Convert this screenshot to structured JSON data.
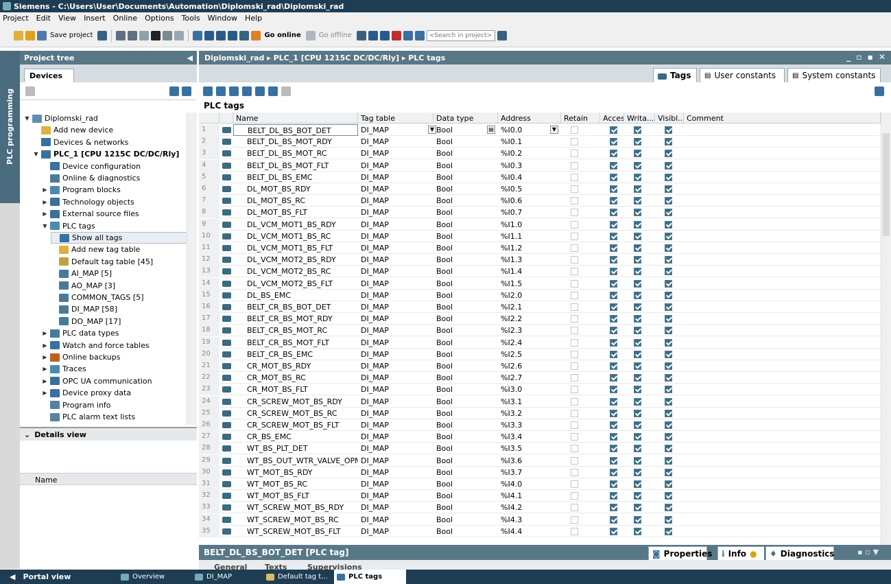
{
  "window": {
    "title": "Siemens - C:\\Users\\User\\Documents\\Automation\\Diplomski_rad\\Diplomski_rad"
  },
  "menu": [
    "Project",
    "Edit",
    "View",
    "Insert",
    "Online",
    "Options",
    "Tools",
    "Window",
    "Help"
  ],
  "toolbar": {
    "save_label": "Save project",
    "go_online": "Go online",
    "go_offline": "Go offline",
    "search_placeholder": "<Search in project>"
  },
  "sidebar_tab": "PLC programming",
  "project_tree": {
    "title": "Project tree",
    "devices_tab": "Devices",
    "items": [
      {
        "label": "Diplomski_rad",
        "indent": 0,
        "arrow": "▼"
      },
      {
        "label": "Add new device",
        "indent": 1,
        "arrow": ""
      },
      {
        "label": "Devices & networks",
        "indent": 1,
        "arrow": ""
      },
      {
        "label": "PLC_1 [CPU 1215C DC/DC/Rly]",
        "indent": 1,
        "arrow": "▼"
      },
      {
        "label": "Device configuration",
        "indent": 2,
        "arrow": ""
      },
      {
        "label": "Online & diagnostics",
        "indent": 2,
        "arrow": ""
      },
      {
        "label": "Program blocks",
        "indent": 2,
        "arrow": "▶"
      },
      {
        "label": "Technology objects",
        "indent": 2,
        "arrow": "▶"
      },
      {
        "label": "External source files",
        "indent": 2,
        "arrow": "▶"
      },
      {
        "label": "PLC tags",
        "indent": 2,
        "arrow": "▼"
      },
      {
        "label": "Show all tags",
        "indent": 3,
        "arrow": ""
      },
      {
        "label": "Add new tag table",
        "indent": 3,
        "arrow": ""
      },
      {
        "label": "Default tag table [45]",
        "indent": 3,
        "arrow": ""
      },
      {
        "label": "AI_MAP [5]",
        "indent": 3,
        "arrow": ""
      },
      {
        "label": "AO_MAP [3]",
        "indent": 3,
        "arrow": ""
      },
      {
        "label": "COMMON_TAGS [5]",
        "indent": 3,
        "arrow": ""
      },
      {
        "label": "DI_MAP [58]",
        "indent": 3,
        "arrow": ""
      },
      {
        "label": "DO_MAP [17]",
        "indent": 3,
        "arrow": ""
      },
      {
        "label": "PLC data types",
        "indent": 2,
        "arrow": "▶"
      },
      {
        "label": "Watch and force tables",
        "indent": 2,
        "arrow": "▶"
      },
      {
        "label": "Online backups",
        "indent": 2,
        "arrow": "▶"
      },
      {
        "label": "Traces",
        "indent": 2,
        "arrow": "▶"
      },
      {
        "label": "OPC UA communication",
        "indent": 2,
        "arrow": "▶"
      },
      {
        "label": "Device proxy data",
        "indent": 2,
        "arrow": "▶"
      },
      {
        "label": "Program info",
        "indent": 2,
        "arrow": ""
      },
      {
        "label": "PLC alarm text lists",
        "indent": 2,
        "arrow": ""
      }
    ]
  },
  "details": {
    "title": "Details view",
    "name_col": "Name"
  },
  "editor": {
    "breadcrumb": "Diplomski_rad  ▸  PLC_1 [CPU 1215C DC/DC/Rly]  ▸  PLC tags",
    "window_controls": "_ ▫ ▪ ✕",
    "tabs": [
      "Tags",
      "User constants",
      "System constants"
    ],
    "section_title": "PLC tags",
    "columns": [
      "",
      "",
      "Name",
      "Tag table",
      "Data type",
      "Address",
      "Retain",
      "Acces...",
      "Writa...",
      "Visibl...",
      "Comment"
    ],
    "rows": [
      [
        "1",
        "BELT_DL_BS_BOT_DET",
        "DI_MAP",
        "Bool",
        "%I0.0"
      ],
      [
        "2",
        "BELT_DL_BS_MOT_RDY",
        "DI_MAP",
        "Bool",
        "%I0.1"
      ],
      [
        "3",
        "BELT_DL_BS_MOT_RC",
        "DI_MAP",
        "Bool",
        "%I0.2"
      ],
      [
        "4",
        "BELT_DL_BS_MOT_FLT",
        "DI_MAP",
        "Bool",
        "%I0.3"
      ],
      [
        "5",
        "BELT_DL_BS_EMC",
        "DI_MAP",
        "Bool",
        "%I0.4"
      ],
      [
        "6",
        "DL_MOT_BS_RDY",
        "DI_MAP",
        "Bool",
        "%I0.5"
      ],
      [
        "7",
        "DL_MOT_BS_RC",
        "DI_MAP",
        "Bool",
        "%I0.6"
      ],
      [
        "8",
        "DL_MOT_BS_FLT",
        "DI_MAP",
        "Bool",
        "%I0.7"
      ],
      [
        "9",
        "DL_VCM_MOT1_BS_RDY",
        "DI_MAP",
        "Bool",
        "%I1.0"
      ],
      [
        "10",
        "DL_VCM_MOT1_BS_RC",
        "DI_MAP",
        "Bool",
        "%I1.1"
      ],
      [
        "11",
        "DL_VCM_MOT1_BS_FLT",
        "DI_MAP",
        "Bool",
        "%I1.2"
      ],
      [
        "12",
        "DL_VCM_MOT2_BS_RDY",
        "DI_MAP",
        "Bool",
        "%I1.3"
      ],
      [
        "13",
        "DL_VCM_MOT2_BS_RC",
        "DI_MAP",
        "Bool",
        "%I1.4"
      ],
      [
        "14",
        "DL_VCM_MOT2_BS_FLT",
        "DI_MAP",
        "Bool",
        "%I1.5"
      ],
      [
        "15",
        "DL_BS_EMC",
        "DI_MAP",
        "Bool",
        "%I2.0"
      ],
      [
        "16",
        "BELT_CR_BS_BOT_DET",
        "DI_MAP",
        "Bool",
        "%I2.1"
      ],
      [
        "17",
        "BELT_CR_BS_MOT_RDY",
        "DI_MAP",
        "Bool",
        "%I2.2"
      ],
      [
        "18",
        "BELT_CR_BS_MOT_RC",
        "DI_MAP",
        "Bool",
        "%I2.3"
      ],
      [
        "19",
        "BELT_CR_BS_MOT_FLT",
        "DI_MAP",
        "Bool",
        "%I2.4"
      ],
      [
        "20",
        "BELT_CR_BS_EMC",
        "DI_MAP",
        "Bool",
        "%I2.5"
      ],
      [
        "21",
        "CR_MOT_BS_RDY",
        "DI_MAP",
        "Bool",
        "%I2.6"
      ],
      [
        "22",
        "CR_MOT_BS_RC",
        "DI_MAP",
        "Bool",
        "%I2.7"
      ],
      [
        "23",
        "CR_MOT_BS_FLT",
        "DI_MAP",
        "Bool",
        "%I3.0"
      ],
      [
        "24",
        "CR_SCREW_MOT_BS_RDY",
        "DI_MAP",
        "Bool",
        "%I3.1"
      ],
      [
        "25",
        "CR_SCREW_MOT_BS_RC",
        "DI_MAP",
        "Bool",
        "%I3.2"
      ],
      [
        "26",
        "CR_SCREW_MOT_BS_FLT",
        "DI_MAP",
        "Bool",
        "%I3.3"
      ],
      [
        "27",
        "CR_BS_EMC",
        "DI_MAP",
        "Bool",
        "%I3.4"
      ],
      [
        "28",
        "WT_BS_PLT_DET",
        "DI_MAP",
        "Bool",
        "%I3.5"
      ],
      [
        "29",
        "WT_BS_OUT_WTR_VALVE_OPN",
        "DI_MAP",
        "Bool",
        "%I3.6"
      ],
      [
        "30",
        "WT_MOT_BS_RDY",
        "DI_MAP",
        "Bool",
        "%I3.7"
      ],
      [
        "31",
        "WT_MOT_BS_RC",
        "DI_MAP",
        "Bool",
        "%I4.0"
      ],
      [
        "32",
        "WT_MOT_BS_FLT",
        "DI_MAP",
        "Bool",
        "%I4.1"
      ],
      [
        "33",
        "WT_SCREW_MOT_BS_RDY",
        "DI_MAP",
        "Bool",
        "%I4.2"
      ],
      [
        "34",
        "WT_SCREW_MOT_BS_RC",
        "DI_MAP",
        "Bool",
        "%I4.3"
      ],
      [
        "35",
        "WT_SCREW_MOT_BS_FLT",
        "DI_MAP",
        "Bool",
        "%I4.4"
      ]
    ]
  },
  "properties": {
    "title": "BELT_DL_BS_BOT_DET [PLC tag]",
    "tabs": [
      "Properties",
      "Info",
      "Diagnostics"
    ],
    "subtabs": [
      "General",
      "Texts",
      "Supervisions"
    ]
  },
  "bottom": {
    "portal_view": "Portal view",
    "items": [
      "Overview",
      "DI_MAP",
      "Default tag t...",
      "PLC tags"
    ]
  }
}
